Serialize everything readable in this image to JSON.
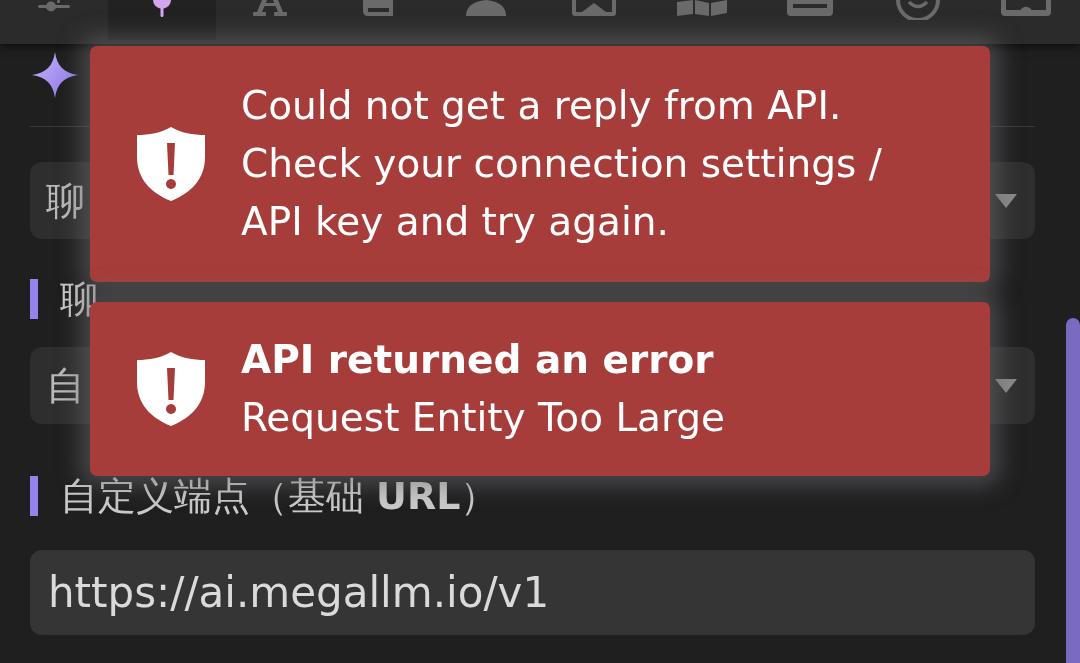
{
  "tabs": [
    {
      "selected": false
    },
    {
      "selected": true
    },
    {
      "selected": false
    },
    {
      "selected": false
    },
    {
      "selected": false
    },
    {
      "selected": false
    },
    {
      "selected": false
    },
    {
      "selected": false
    },
    {
      "selected": false
    },
    {
      "selected": false
    }
  ],
  "settings": {
    "fields": [
      {
        "kind": "select",
        "value": "聊"
      },
      {
        "kind": "label",
        "text": "聊"
      },
      {
        "kind": "select",
        "value": "自"
      },
      {
        "kind": "label",
        "text": "自定义端点（基础 **URL**）"
      },
      {
        "kind": "input",
        "value": "https://ai.megallm.io/v1"
      }
    ]
  },
  "toasts": [
    {
      "message": "Could not get a reply from API. Check your connection settings / API key and try again."
    },
    {
      "title": "API returned an error",
      "message": "Request Entity Too Large"
    }
  ]
}
